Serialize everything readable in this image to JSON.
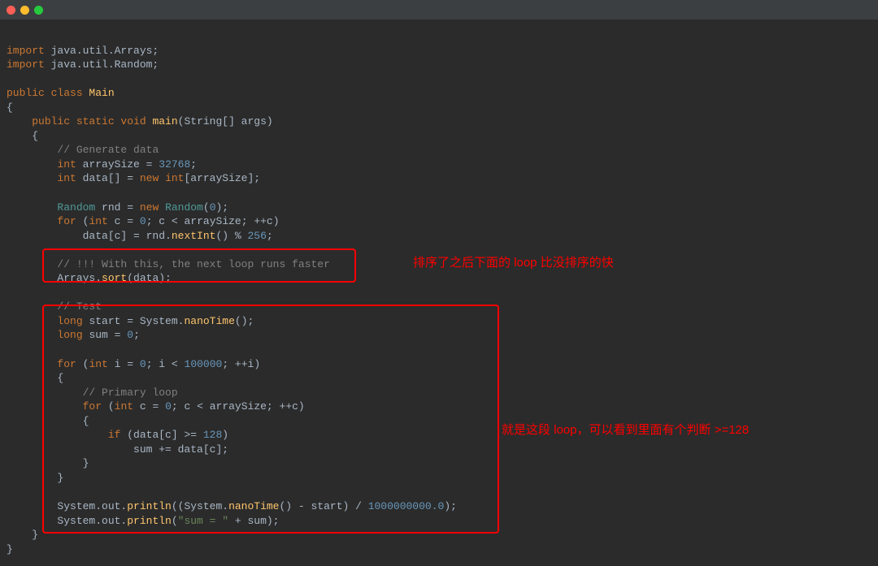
{
  "code": {
    "lines": [
      {
        "tokens": [
          {
            "text": "",
            "class": ""
          }
        ]
      },
      {
        "tokens": [
          {
            "text": "import ",
            "class": "kw"
          },
          {
            "text": "java.util.Arrays;",
            "class": "ident"
          }
        ]
      },
      {
        "tokens": [
          {
            "text": "import ",
            "class": "kw"
          },
          {
            "text": "java.util.Random;",
            "class": "ident"
          }
        ]
      },
      {
        "tokens": [
          {
            "text": "",
            "class": ""
          }
        ]
      },
      {
        "tokens": [
          {
            "text": "public class ",
            "class": "kw"
          },
          {
            "text": "Main",
            "class": "func"
          }
        ]
      },
      {
        "tokens": [
          {
            "text": "{",
            "class": "punct"
          }
        ]
      },
      {
        "tokens": [
          {
            "text": "    ",
            "class": ""
          },
          {
            "text": "public static void ",
            "class": "kw"
          },
          {
            "text": "main",
            "class": "func"
          },
          {
            "text": "(String[] args)",
            "class": "ident"
          }
        ]
      },
      {
        "tokens": [
          {
            "text": "    {",
            "class": "punct"
          }
        ]
      },
      {
        "tokens": [
          {
            "text": "        ",
            "class": ""
          },
          {
            "text": "// Generate data",
            "class": "comment"
          }
        ]
      },
      {
        "tokens": [
          {
            "text": "        ",
            "class": ""
          },
          {
            "text": "int ",
            "class": "kw"
          },
          {
            "text": "arraySize = ",
            "class": "ident"
          },
          {
            "text": "32768",
            "class": "num"
          },
          {
            "text": ";",
            "class": "punct"
          }
        ]
      },
      {
        "tokens": [
          {
            "text": "        ",
            "class": ""
          },
          {
            "text": "int ",
            "class": "kw"
          },
          {
            "text": "data[] = ",
            "class": "ident"
          },
          {
            "text": "new int",
            "class": "kw"
          },
          {
            "text": "[arraySize];",
            "class": "ident"
          }
        ]
      },
      {
        "tokens": [
          {
            "text": "",
            "class": ""
          }
        ]
      },
      {
        "tokens": [
          {
            "text": "        ",
            "class": ""
          },
          {
            "text": "Random ",
            "class": "teal"
          },
          {
            "text": "rnd = ",
            "class": "ident"
          },
          {
            "text": "new ",
            "class": "kw"
          },
          {
            "text": "Random",
            "class": "teal"
          },
          {
            "text": "(",
            "class": "punct"
          },
          {
            "text": "0",
            "class": "num"
          },
          {
            "text": ");",
            "class": "punct"
          }
        ]
      },
      {
        "tokens": [
          {
            "text": "        ",
            "class": ""
          },
          {
            "text": "for ",
            "class": "kw"
          },
          {
            "text": "(",
            "class": "punct"
          },
          {
            "text": "int ",
            "class": "kw"
          },
          {
            "text": "c = ",
            "class": "ident"
          },
          {
            "text": "0",
            "class": "num"
          },
          {
            "text": "; c < arraySize; ++c)",
            "class": "ident"
          }
        ]
      },
      {
        "tokens": [
          {
            "text": "            data[c] = rnd.",
            "class": "ident"
          },
          {
            "text": "nextInt",
            "class": "func"
          },
          {
            "text": "() % ",
            "class": "ident"
          },
          {
            "text": "256",
            "class": "num"
          },
          {
            "text": ";",
            "class": "punct"
          }
        ]
      },
      {
        "tokens": [
          {
            "text": "",
            "class": ""
          }
        ]
      },
      {
        "tokens": [
          {
            "text": "        ",
            "class": ""
          },
          {
            "text": "// !!! With this, the next loop runs faster",
            "class": "comment"
          }
        ]
      },
      {
        "tokens": [
          {
            "text": "        Arrays.",
            "class": "ident"
          },
          {
            "text": "sort",
            "class": "func"
          },
          {
            "text": "(data);",
            "class": "ident"
          }
        ]
      },
      {
        "tokens": [
          {
            "text": "",
            "class": ""
          }
        ]
      },
      {
        "tokens": [
          {
            "text": "        ",
            "class": ""
          },
          {
            "text": "// Test",
            "class": "comment"
          }
        ]
      },
      {
        "tokens": [
          {
            "text": "        ",
            "class": ""
          },
          {
            "text": "long ",
            "class": "kw"
          },
          {
            "text": "start = System.",
            "class": "ident"
          },
          {
            "text": "nanoTime",
            "class": "func"
          },
          {
            "text": "();",
            "class": "ident"
          }
        ]
      },
      {
        "tokens": [
          {
            "text": "        ",
            "class": ""
          },
          {
            "text": "long ",
            "class": "kw"
          },
          {
            "text": "sum = ",
            "class": "ident"
          },
          {
            "text": "0",
            "class": "num"
          },
          {
            "text": ";",
            "class": "punct"
          }
        ]
      },
      {
        "tokens": [
          {
            "text": "",
            "class": ""
          }
        ]
      },
      {
        "tokens": [
          {
            "text": "        ",
            "class": ""
          },
          {
            "text": "for ",
            "class": "kw"
          },
          {
            "text": "(",
            "class": "punct"
          },
          {
            "text": "int ",
            "class": "kw"
          },
          {
            "text": "i = ",
            "class": "ident"
          },
          {
            "text": "0",
            "class": "num"
          },
          {
            "text": "; i < ",
            "class": "ident"
          },
          {
            "text": "100000",
            "class": "num"
          },
          {
            "text": "; ++i)",
            "class": "ident"
          }
        ]
      },
      {
        "tokens": [
          {
            "text": "        {",
            "class": "punct"
          }
        ]
      },
      {
        "tokens": [
          {
            "text": "            ",
            "class": ""
          },
          {
            "text": "// Primary loop",
            "class": "comment"
          }
        ]
      },
      {
        "tokens": [
          {
            "text": "            ",
            "class": ""
          },
          {
            "text": "for ",
            "class": "kw"
          },
          {
            "text": "(",
            "class": "punct"
          },
          {
            "text": "int ",
            "class": "kw"
          },
          {
            "text": "c = ",
            "class": "ident"
          },
          {
            "text": "0",
            "class": "num"
          },
          {
            "text": "; c < arraySize; ++c)",
            "class": "ident"
          }
        ]
      },
      {
        "tokens": [
          {
            "text": "            {",
            "class": "punct"
          }
        ]
      },
      {
        "tokens": [
          {
            "text": "                ",
            "class": ""
          },
          {
            "text": "if ",
            "class": "kw"
          },
          {
            "text": "(data[c] >= ",
            "class": "ident"
          },
          {
            "text": "128",
            "class": "num"
          },
          {
            "text": ")",
            "class": "punct"
          }
        ]
      },
      {
        "tokens": [
          {
            "text": "                    sum += data[c];",
            "class": "ident"
          }
        ]
      },
      {
        "tokens": [
          {
            "text": "            }",
            "class": "punct"
          }
        ]
      },
      {
        "tokens": [
          {
            "text": "        }",
            "class": "punct"
          }
        ]
      },
      {
        "tokens": [
          {
            "text": "",
            "class": ""
          }
        ]
      },
      {
        "tokens": [
          {
            "text": "        System.out.",
            "class": "ident"
          },
          {
            "text": "println",
            "class": "func"
          },
          {
            "text": "((System.",
            "class": "ident"
          },
          {
            "text": "nanoTime",
            "class": "func"
          },
          {
            "text": "() - start) / ",
            "class": "ident"
          },
          {
            "text": "1000000000.0",
            "class": "num"
          },
          {
            "text": ");",
            "class": "punct"
          }
        ]
      },
      {
        "tokens": [
          {
            "text": "        System.out.",
            "class": "ident"
          },
          {
            "text": "println",
            "class": "func"
          },
          {
            "text": "(",
            "class": "punct"
          },
          {
            "text": "\"sum = \"",
            "class": "str"
          },
          {
            "text": " + sum);",
            "class": "ident"
          }
        ]
      },
      {
        "tokens": [
          {
            "text": "    }",
            "class": "punct"
          }
        ]
      },
      {
        "tokens": [
          {
            "text": "}",
            "class": "punct"
          }
        ]
      }
    ]
  },
  "annotations": {
    "ann1": "排序了之后下面的 loop 比没排序的快",
    "ann2": "就是这段 loop，可以看到里面有个判断 >=128"
  }
}
